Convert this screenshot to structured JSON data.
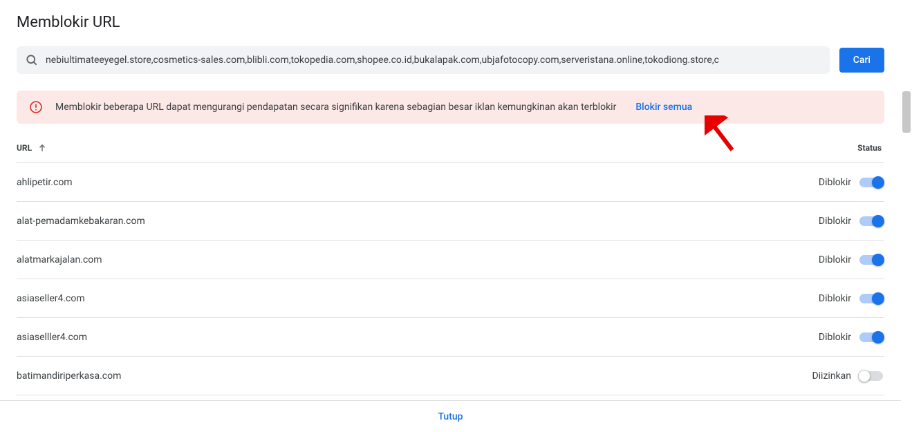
{
  "title": "Memblokir URL",
  "search": {
    "value": "nebiultimateeyegel.store,cosmetics-sales.com,blibli.com,tokopedia.com,shopee.co.id,bukalapak.com,ubjafotocopy.com,serveristana.online,tokodiong.store,c",
    "button": "Cari"
  },
  "alert": {
    "text": "Memblokir beberapa URL dapat mengurangi pendapatan secara signifikan karena sebagian besar iklan kemungkinan akan terblokir",
    "action": "Blokir semua"
  },
  "columns": {
    "url": "URL",
    "status": "Status"
  },
  "status_labels": {
    "blocked": "Diblokir",
    "allowed": "Diizinkan"
  },
  "rows": [
    {
      "url": "ahlipetir.com",
      "status": "Diblokir",
      "on": true
    },
    {
      "url": "alat-pemadamkebakaran.com",
      "status": "Diblokir",
      "on": true
    },
    {
      "url": "alatmarkajalan.com",
      "status": "Diblokir",
      "on": true
    },
    {
      "url": "asiaseller4.com",
      "status": "Diblokir",
      "on": true
    },
    {
      "url": "asiaselller4.com",
      "status": "Diblokir",
      "on": true
    },
    {
      "url": "batimandiriperkasa.com",
      "status": "Diizinkan",
      "on": false
    }
  ],
  "footer": {
    "close": "Tutup"
  },
  "colors": {
    "accent": "#1a73e8",
    "danger": "#d93025",
    "alert_bg": "#fce8e6"
  }
}
